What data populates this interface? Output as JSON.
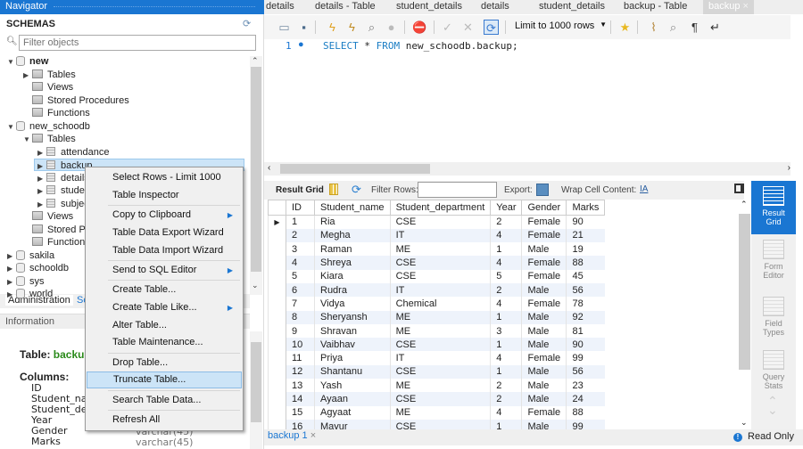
{
  "navigator": {
    "title": "Navigator",
    "schemas_label": "SCHEMAS",
    "filter_placeholder": "Filter objects",
    "tree": [
      {
        "label": "new",
        "type": "schema",
        "expanded": true,
        "bold": true
      },
      {
        "label": "Tables",
        "type": "folder"
      },
      {
        "label": "Views",
        "type": "folder"
      },
      {
        "label": "Stored Procedures",
        "type": "folder"
      },
      {
        "label": "Functions",
        "type": "folder"
      },
      {
        "label": "new_schoodb",
        "type": "schema",
        "expanded": true
      },
      {
        "label": "Tables",
        "type": "folder",
        "expanded": true
      },
      {
        "label": "attendance",
        "type": "table"
      },
      {
        "label": "backup",
        "type": "table",
        "selected": true
      },
      {
        "label": "details",
        "type": "table"
      },
      {
        "label": "student_details",
        "type": "table"
      },
      {
        "label": "subjects",
        "type": "table"
      },
      {
        "label": "Views",
        "type": "folder"
      },
      {
        "label": "Stored Procedures",
        "type": "folder"
      },
      {
        "label": "Functions",
        "type": "folder"
      },
      {
        "label": "sakila",
        "type": "schema"
      },
      {
        "label": "schooldb",
        "type": "schema"
      },
      {
        "label": "sys",
        "type": "schema"
      },
      {
        "label": "world",
        "type": "schema"
      }
    ],
    "tabs": {
      "administration": "Administration",
      "schemas": "Schemas"
    },
    "information_label": "Information",
    "info": {
      "table_label": "Table:",
      "table_name": "backup",
      "columns_label": "Columns:",
      "columns": [
        {
          "name": "ID",
          "type": ""
        },
        {
          "name": "Student_name",
          "type": ""
        },
        {
          "name": "Student_department",
          "type": ""
        },
        {
          "name": "Year",
          "type": ""
        },
        {
          "name": "Gender",
          "type": "varchar(45)"
        },
        {
          "name": "Marks",
          "type": "varchar(45)"
        }
      ]
    }
  },
  "context_menu": {
    "items": [
      {
        "label": "Select Rows - Limit 1000"
      },
      {
        "label": "Table Inspector"
      },
      {
        "label": "Copy to Clipboard",
        "submenu": true
      },
      {
        "label": "Table Data Export Wizard"
      },
      {
        "label": "Table Data Import Wizard"
      },
      {
        "label": "Send to SQL Editor",
        "submenu": true
      },
      {
        "label": "Create Table..."
      },
      {
        "label": "Create Table Like...",
        "submenu": true
      },
      {
        "label": "Alter Table..."
      },
      {
        "label": "Table Maintenance..."
      },
      {
        "label": "Drop Table..."
      },
      {
        "label": "Truncate Table...",
        "highlighted": true
      },
      {
        "label": "Search Table Data..."
      },
      {
        "label": "Refresh All"
      }
    ]
  },
  "editor_tabs": [
    "details",
    "details - Table",
    "student_details",
    "details",
    "student_details",
    "backup - Table",
    "backup"
  ],
  "active_tab": "backup",
  "toolbar": {
    "limit_label": "Limit to 1000 rows",
    "icons": [
      "open-folder-icon",
      "save-icon",
      "execute-icon",
      "execute-current-icon",
      "explain-icon",
      "stop-icon",
      "toggle-error-icon",
      "commit-icon",
      "rollback-icon",
      "autocommit-icon",
      "bookmark-add-icon",
      "beautify-icon",
      "find-icon",
      "invisible-chars-icon",
      "wrap-icon"
    ]
  },
  "editor": {
    "line_number": "1",
    "sql_keyword1": "SELECT",
    "sql_star": " * ",
    "sql_keyword2": "FROM",
    "sql_rest": " new_schoodb.backup;"
  },
  "result_bar": {
    "result_grid": "Result Grid",
    "filter_rows": "Filter Rows:",
    "filter_value": "",
    "export": "Export:",
    "wrap": "Wrap Cell Content:"
  },
  "grid": {
    "columns": [
      "ID",
      "Student_name",
      "Student_department",
      "Year",
      "Gender",
      "Marks"
    ],
    "rows": [
      [
        "1",
        "Ria",
        "CSE",
        "2",
        "Female",
        "90"
      ],
      [
        "2",
        "Megha",
        "IT",
        "4",
        "Female",
        "21"
      ],
      [
        "3",
        "Raman",
        "ME",
        "1",
        "Male",
        "19"
      ],
      [
        "4",
        "Shreya",
        "CSE",
        "4",
        "Female",
        "88"
      ],
      [
        "5",
        "Kiara",
        "CSE",
        "5",
        "Female",
        "45"
      ],
      [
        "6",
        "Rudra",
        "IT",
        "2",
        "Male",
        "56"
      ],
      [
        "7",
        "Vidya",
        "Chemical",
        "4",
        "Female",
        "78"
      ],
      [
        "8",
        "Sheryansh",
        "ME",
        "1",
        "Male",
        "92"
      ],
      [
        "9",
        "Shravan",
        "ME",
        "3",
        "Male",
        "81"
      ],
      [
        "10",
        "Vaibhav",
        "CSE",
        "1",
        "Male",
        "90"
      ],
      [
        "11",
        "Priya",
        "IT",
        "4",
        "Female",
        "99"
      ],
      [
        "12",
        "Shantanu",
        "CSE",
        "1",
        "Male",
        "56"
      ],
      [
        "13",
        "Yash",
        "ME",
        "2",
        "Male",
        "23"
      ],
      [
        "14",
        "Ayaan",
        "CSE",
        "2",
        "Male",
        "24"
      ],
      [
        "15",
        "Agyaat",
        "ME",
        "4",
        "Female",
        "88"
      ],
      [
        "16",
        "Mayur",
        "CSE",
        "1",
        "Male",
        "99"
      ]
    ]
  },
  "side_panel": [
    {
      "label": "Result Grid",
      "active": true
    },
    {
      "label": "Form Editor"
    },
    {
      "label": "Field Types"
    },
    {
      "label": "Query Stats"
    }
  ],
  "bottom": {
    "result_tab": "backup 1",
    "status": "Read Only"
  }
}
